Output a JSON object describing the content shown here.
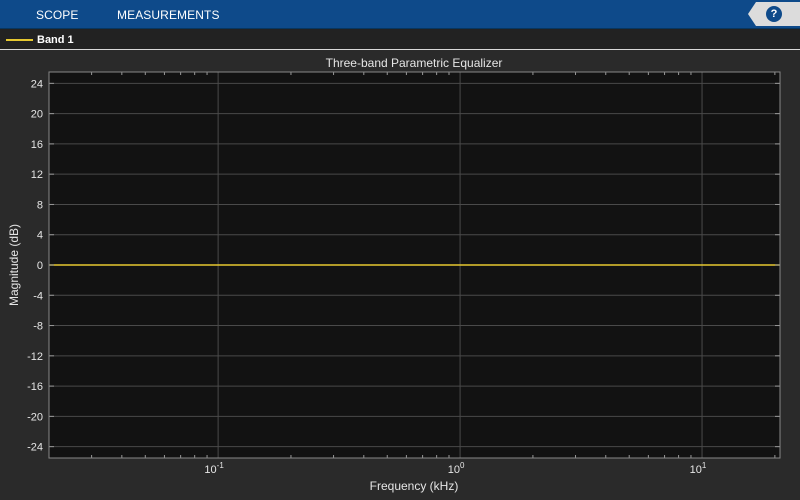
{
  "toolbar": {
    "tabs": [
      "SCOPE",
      "MEASUREMENTS"
    ],
    "help_label": "?",
    "help_icon": "help-icon"
  },
  "legend": {
    "items": [
      {
        "label": "Band 1",
        "color": "#e6c830"
      }
    ]
  },
  "colors": {
    "toolbar": "#0e4a8a",
    "plot_background": "#121212",
    "figure_background": "#2a2a2a",
    "grid": "#4a4a4a",
    "axis_text": "#e6e6e6",
    "series": "#e6c830"
  },
  "chart_data": {
    "type": "line",
    "title": "Three-band Parametric Equalizer",
    "xlabel": "Frequency (kHz)",
    "ylabel": "Magnitude (dB)",
    "xscale": "log",
    "xlim": [
      0.02,
      21
    ],
    "ylim": [
      -25.5,
      25.5
    ],
    "grid": true,
    "legend_position": "top-left",
    "x_ticks": [
      {
        "value": 0.1,
        "base": "10",
        "exp": "-1"
      },
      {
        "value": 1,
        "base": "10",
        "exp": "0"
      },
      {
        "value": 10,
        "base": "10",
        "exp": "1"
      }
    ],
    "y_ticks": [
      {
        "value": 24,
        "label": "24"
      },
      {
        "value": 20,
        "label": "20"
      },
      {
        "value": 16,
        "label": "16"
      },
      {
        "value": 12,
        "label": "12"
      },
      {
        "value": 8,
        "label": "8"
      },
      {
        "value": 4,
        "label": "4"
      },
      {
        "value": 0,
        "label": "0"
      },
      {
        "value": -4,
        "label": "-4"
      },
      {
        "value": -8,
        "label": "-8"
      },
      {
        "value": -12,
        "label": "-12"
      },
      {
        "value": -16,
        "label": "-16"
      },
      {
        "value": -20,
        "label": "-20"
      },
      {
        "value": -24,
        "label": "-24"
      }
    ],
    "series": [
      {
        "name": "Band 1",
        "x": [
          0.02,
          0.1,
          1,
          10,
          21
        ],
        "values": [
          0,
          0,
          0,
          0,
          0
        ]
      }
    ]
  }
}
